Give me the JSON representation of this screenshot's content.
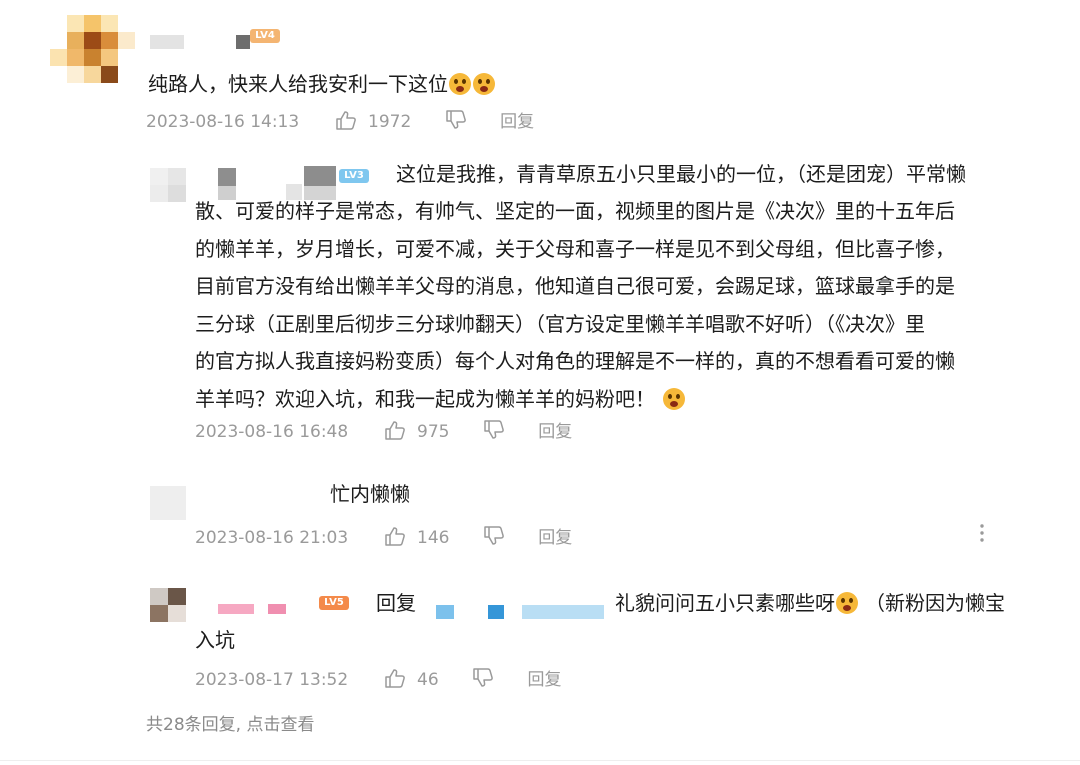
{
  "comments": [
    {
      "level": "LV4",
      "text": "纯路人，快来人给我安利一下这位",
      "time": "2023-08-16 14:13",
      "likes": "1972",
      "reply_label": "回复"
    }
  ],
  "replies": [
    {
      "level": "LV3",
      "lines": [
        "这位是我推，青青草原五小只里最小的一位，（还是团宠）平常懒",
        "散、可爱的样子是常态，有帅气、坚定的一面，视频里的图片是《决次》里的十五年后",
        "的懒羊羊，岁月增长，可爱不减，关于父母和喜子一样是见不到父母组，但比喜子惨，",
        "目前官方没有给出懒羊羊父母的消息，他知道自己很可爱，会踢足球，篮球最拿手的是",
        "三分球（正剧里后彻步三分球帅翻天）（官方设定里懒羊羊唱歌不好听）（《决次》里",
        "的官方拟人我直接妈粉变质）每个人对角色的理解是不一样的，真的不想看看可爱的懒",
        "羊羊吗？欢迎入坑，和我一起成为懒羊羊的妈粉吧！"
      ],
      "time": "2023-08-16 16:48",
      "likes": "975",
      "reply_label": "回复"
    },
    {
      "text": "忙内懒懒",
      "time": "2023-08-16 21:03",
      "likes": "146",
      "reply_label": "回复"
    },
    {
      "level": "LV5",
      "reply_word": "回复",
      "lines": [
        "礼貌问问五小只素哪些呀",
        "（新粉因为懒宝",
        "入坑"
      ],
      "time": "2023-08-17 13:52",
      "likes": "46",
      "reply_label": "回复"
    }
  ],
  "view_more": "共28条回复, 点击查看",
  "icons": [
    "thumbs-up-icon",
    "thumbs-down-icon",
    "more-vertical-icon",
    "emoji-icon"
  ],
  "colors": {
    "meta_gray": "#9a9a9a",
    "lv4": "#f4b572",
    "lv3": "#7fc7ef",
    "lv5": "#f48a4a"
  }
}
